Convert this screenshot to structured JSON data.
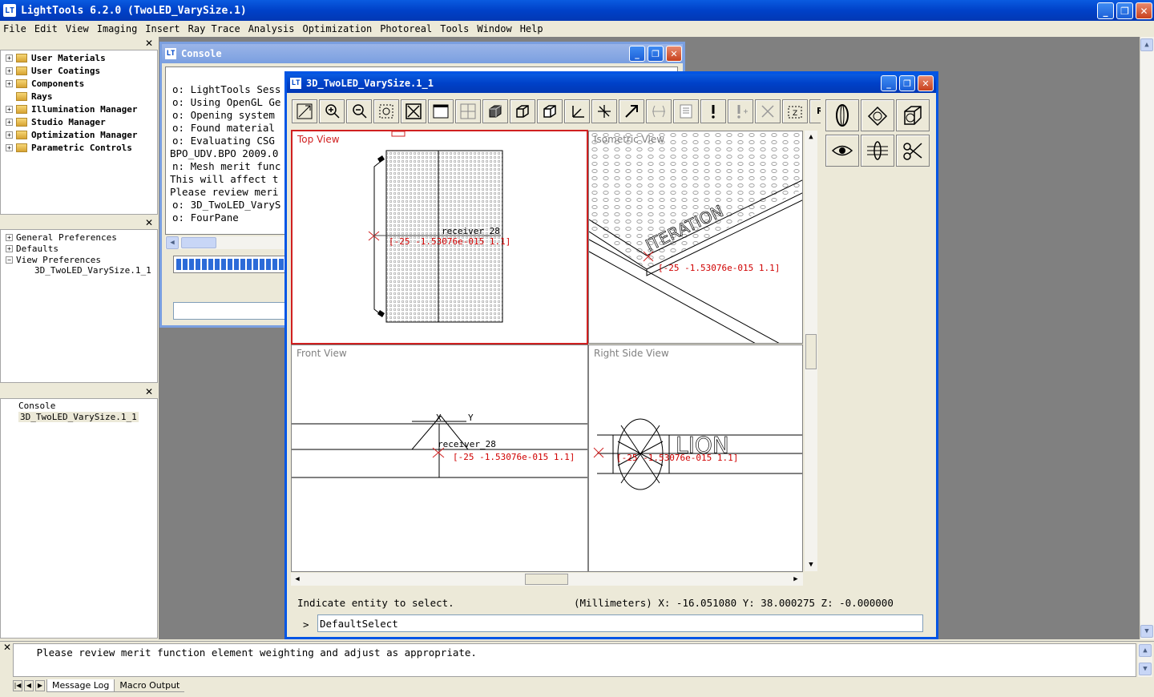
{
  "app": {
    "title": "LightTools 6.2.0  (TwoLED_VarySize.1)",
    "icon_text": "LT",
    "caption_buttons": {
      "minimize": "_",
      "restore": "❐",
      "close": "✕"
    }
  },
  "menu": [
    "File",
    "Edit",
    "View",
    "Imaging",
    "Insert",
    "Ray Trace",
    "Analysis",
    "Optimization",
    "Photoreal",
    "Tools",
    "Window",
    "Help"
  ],
  "left_panel": {
    "tree1": [
      "User Materials",
      "User Coatings",
      "Components",
      "Rays",
      "Illumination Manager",
      "Studio Manager",
      "Optimization Manager",
      "Parametric Controls"
    ],
    "tree2": [
      {
        "label": "General Preferences",
        "expander": "+"
      },
      {
        "label": "Defaults",
        "expander": "+"
      },
      {
        "label": "View Preferences",
        "expander": "−"
      },
      {
        "label": "3D_TwoLED_VarySize.1_1",
        "expander": ""
      }
    ],
    "tree3": [
      "Console",
      "3D_TwoLED_VarySize.1_1"
    ],
    "close_glyph": "✕"
  },
  "console": {
    "title": "Console",
    "lines": [
      "o: LightTools Sess",
      "o: Using OpenGL Ge",
      "o: Opening system",
      "o: Found material",
      "o: Evaluating CSG",
      "BPO_UDV.BPO 2009.0",
      "n: Mesh merit func",
      "This will affect t",
      "Please review meri",
      "o: 3D_TwoLED_VaryS",
      "o: FourPane"
    ]
  },
  "view3d": {
    "title": "3D_TwoLED_VarySize.1_1",
    "panes": {
      "top": "Top View",
      "iso": "Isometric View",
      "front": "Front View",
      "right": "Right Side View"
    },
    "coord_label": "[-25 -1.53076e-015 1.1]",
    "receiver_label": "receiver_28",
    "axis_x": "X",
    "axis_y": "Y",
    "iso_text": "ITERATION",
    "side_text": "LION",
    "status_left": "Indicate entity to select.",
    "status_right": "(Millimeters) X: -16.051080 Y:  38.000275 Z:  -0.000000",
    "cmd_prompt": ">",
    "cmd_value": "DefaultSelect"
  },
  "message_log": {
    "text": "   Please review merit function element weighting and adjust as appropriate.",
    "tabs": [
      "Message Log",
      "Macro Output"
    ]
  }
}
